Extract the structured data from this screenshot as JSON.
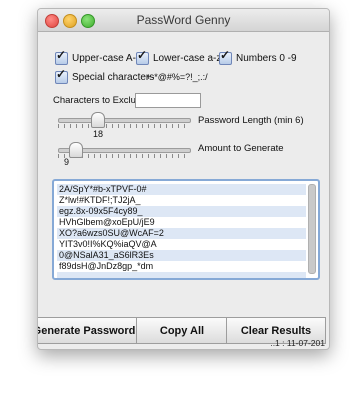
{
  "window": {
    "title": "PassWord Genny"
  },
  "options": {
    "uppercase_label": "Upper-case A-Z",
    "lowercase_label": "Lower-case a-z",
    "numbers_label": "Numbers 0 -9",
    "special_label": "Special characters",
    "special_chars": "+-*@#%=?!_;.:/",
    "uppercase_checked": true,
    "lowercase_checked": true,
    "numbers_checked": true,
    "special_checked": true
  },
  "exclude": {
    "label": "Characters to Exclude",
    "value": ""
  },
  "length_slider": {
    "label": "Password Length (min 6)",
    "value": "18",
    "fraction": 0.3
  },
  "amount_slider": {
    "label": "Amount to Generate",
    "value": "9",
    "fraction": 0.13
  },
  "output": {
    "lines": [
      "2A/SpY*#b-xTPVF-0#",
      "Z*lw!#KTDF!;TJ2jA_",
      "egz.8x-09x5F4cy89_",
      "HVhGlbem@xoEpU/jE9",
      "XO?a6wzs0SU@WcAF=2",
      "YIT3v0!I%KQ%iaQV@A",
      "0@NSalA31_aS6lR3Es",
      "f89dsH@JnDz8gp_*dm",
      ""
    ]
  },
  "buttons": {
    "generate": "Generate Password",
    "copy": "Copy All",
    "clear": "Clear Results"
  },
  "status": {
    "version": "..1 : 11-07-201"
  }
}
